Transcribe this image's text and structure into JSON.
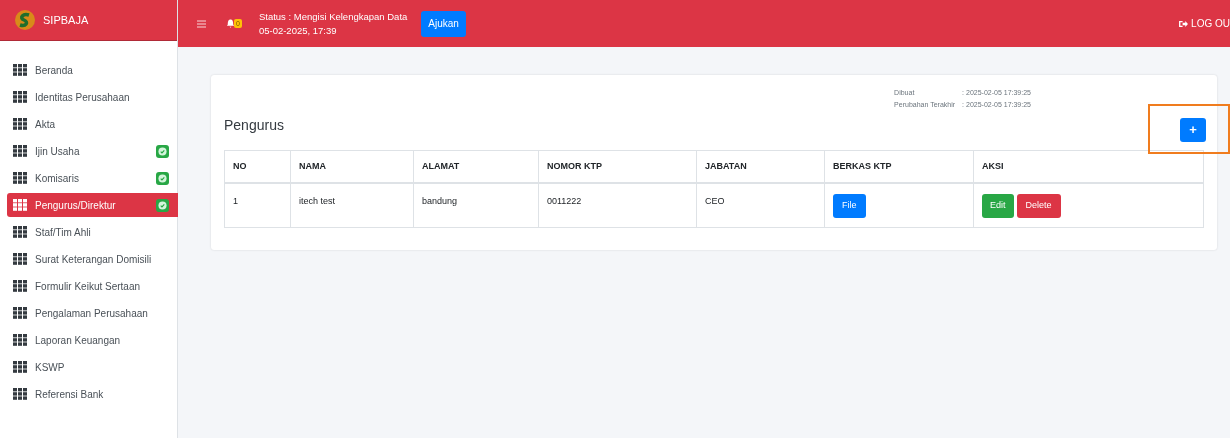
{
  "brand": {
    "name": "SIPBAJA"
  },
  "topbar": {
    "notification_count": "0",
    "status": "Status : Mengisi Kelengkapan Data",
    "date": "05-02-2025, 17:39",
    "submit_button": "Ajukan",
    "logout": "LOG OU"
  },
  "sidebar": {
    "items": [
      {
        "label": "Beranda",
        "selected": false,
        "done": false
      },
      {
        "label": "Identitas Perusahaan",
        "selected": false,
        "done": false
      },
      {
        "label": "Akta",
        "selected": false,
        "done": false
      },
      {
        "label": "Ijin Usaha",
        "selected": false,
        "done": true
      },
      {
        "label": "Komisaris",
        "selected": false,
        "done": true
      },
      {
        "label": "Pengurus/Direktur",
        "selected": true,
        "done": true
      },
      {
        "label": "Staf/Tim Ahli",
        "selected": false,
        "done": false
      },
      {
        "label": "Surat Keterangan Domisili",
        "selected": false,
        "done": false
      },
      {
        "label": "Formulir Keikut Sertaan",
        "selected": false,
        "done": false
      },
      {
        "label": "Pengalaman Perusahaan",
        "selected": false,
        "done": false
      },
      {
        "label": "Laporan Keuangan",
        "selected": false,
        "done": false
      },
      {
        "label": "KSWP",
        "selected": false,
        "done": false
      },
      {
        "label": "Referensi Bank",
        "selected": false,
        "done": false
      }
    ]
  },
  "card": {
    "meta": [
      {
        "label": "Dibuat",
        "value": ": 2025-02-05 17:39:25"
      },
      {
        "label": "Perubahan Terakhir",
        "value": ": 2025-02-05 17:39:25"
      }
    ],
    "title": "Pengurus",
    "add_button": "+",
    "add_highlighted": true,
    "table": {
      "columns": [
        "NO",
        "NAMA",
        "ALAMAT",
        "NOMOR KTP",
        "JABATAN",
        "BERKAS KTP",
        "AKSI"
      ],
      "rows": [
        {
          "no": "1",
          "nama": "itech test",
          "alamat": "bandung",
          "nomor_ktp": "0011222",
          "jabatan": "CEO",
          "file_button": "File",
          "edit_button": "Edit",
          "delete_button": "Delete"
        }
      ]
    }
  }
}
